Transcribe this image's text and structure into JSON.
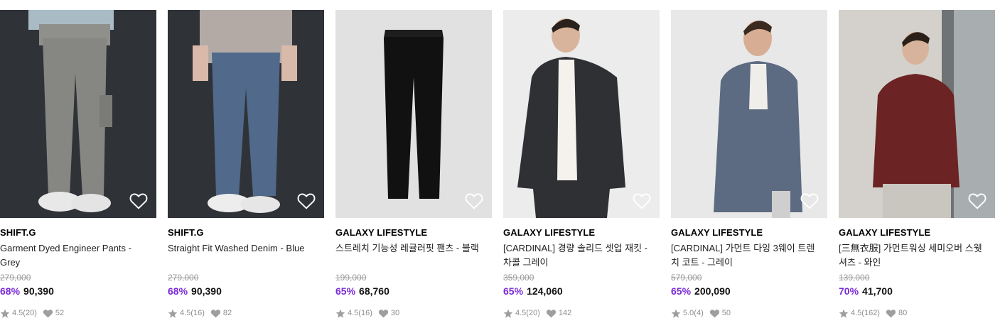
{
  "products": [
    {
      "brand": "SHIFT.G",
      "name": "Garment Dyed Engineer Pants - Grey",
      "original_price": "279,000",
      "discount": "68%",
      "price": "90,390",
      "rating": "4.5(20)",
      "likes": "52",
      "image": "grey-cargo-pants-model",
      "bg": "#2d3136"
    },
    {
      "brand": "SHIFT.G",
      "name": "Straight Fit Washed Denim - Blue",
      "original_price": "279,000",
      "discount": "68%",
      "price": "90,390",
      "rating": "4.5(16)",
      "likes": "82",
      "image": "blue-denim-model",
      "bg": "#2d3136"
    },
    {
      "brand": "GALAXY LIFESTYLE",
      "name": "스트레치 기능성 레귤러핏 팬츠 - 블랙",
      "original_price": "199,000",
      "discount": "65%",
      "price": "68,760",
      "rating": "4.5(16)",
      "likes": "30",
      "image": "black-trousers-flat",
      "bg": "#e3e3e3"
    },
    {
      "brand": "GALAXY LIFESTYLE",
      "name": "[CARDINAL] 경량 솔리드 셋업 재킷 - 차콜 그레이",
      "original_price": "359,000",
      "discount": "65%",
      "price": "124,060",
      "rating": "4.5(20)",
      "likes": "142",
      "image": "charcoal-blazer-model",
      "bg": "#ececec"
    },
    {
      "brand": "GALAXY LIFESTYLE",
      "name": "[CARDINAL] 가먼트 다잉 3웨이 트렌치 코트 - 그레이",
      "original_price": "579,000",
      "discount": "65%",
      "price": "200,090",
      "rating": "5.0(4)",
      "likes": "50",
      "image": "grey-trench-coat-model",
      "bg": "#e9e9e9"
    },
    {
      "brand": "GALAXY LIFESTYLE",
      "name": "[三無衣服] 가먼트워싱 세미오버 스웻셔츠 - 와인",
      "original_price": "139,000",
      "discount": "70%",
      "price": "41,700",
      "rating": "4.5(162)",
      "likes": "80",
      "image": "wine-sweatshirt-model",
      "bg": "#d6d3cf"
    }
  ],
  "colors": {
    "discount": "#7b2bd6",
    "strike": "#9a9a9a",
    "meta": "#8d8d8d"
  },
  "icons": {
    "wishlist": "heart-outline-icon",
    "rating": "star-icon",
    "likes": "heart-filled-icon"
  }
}
